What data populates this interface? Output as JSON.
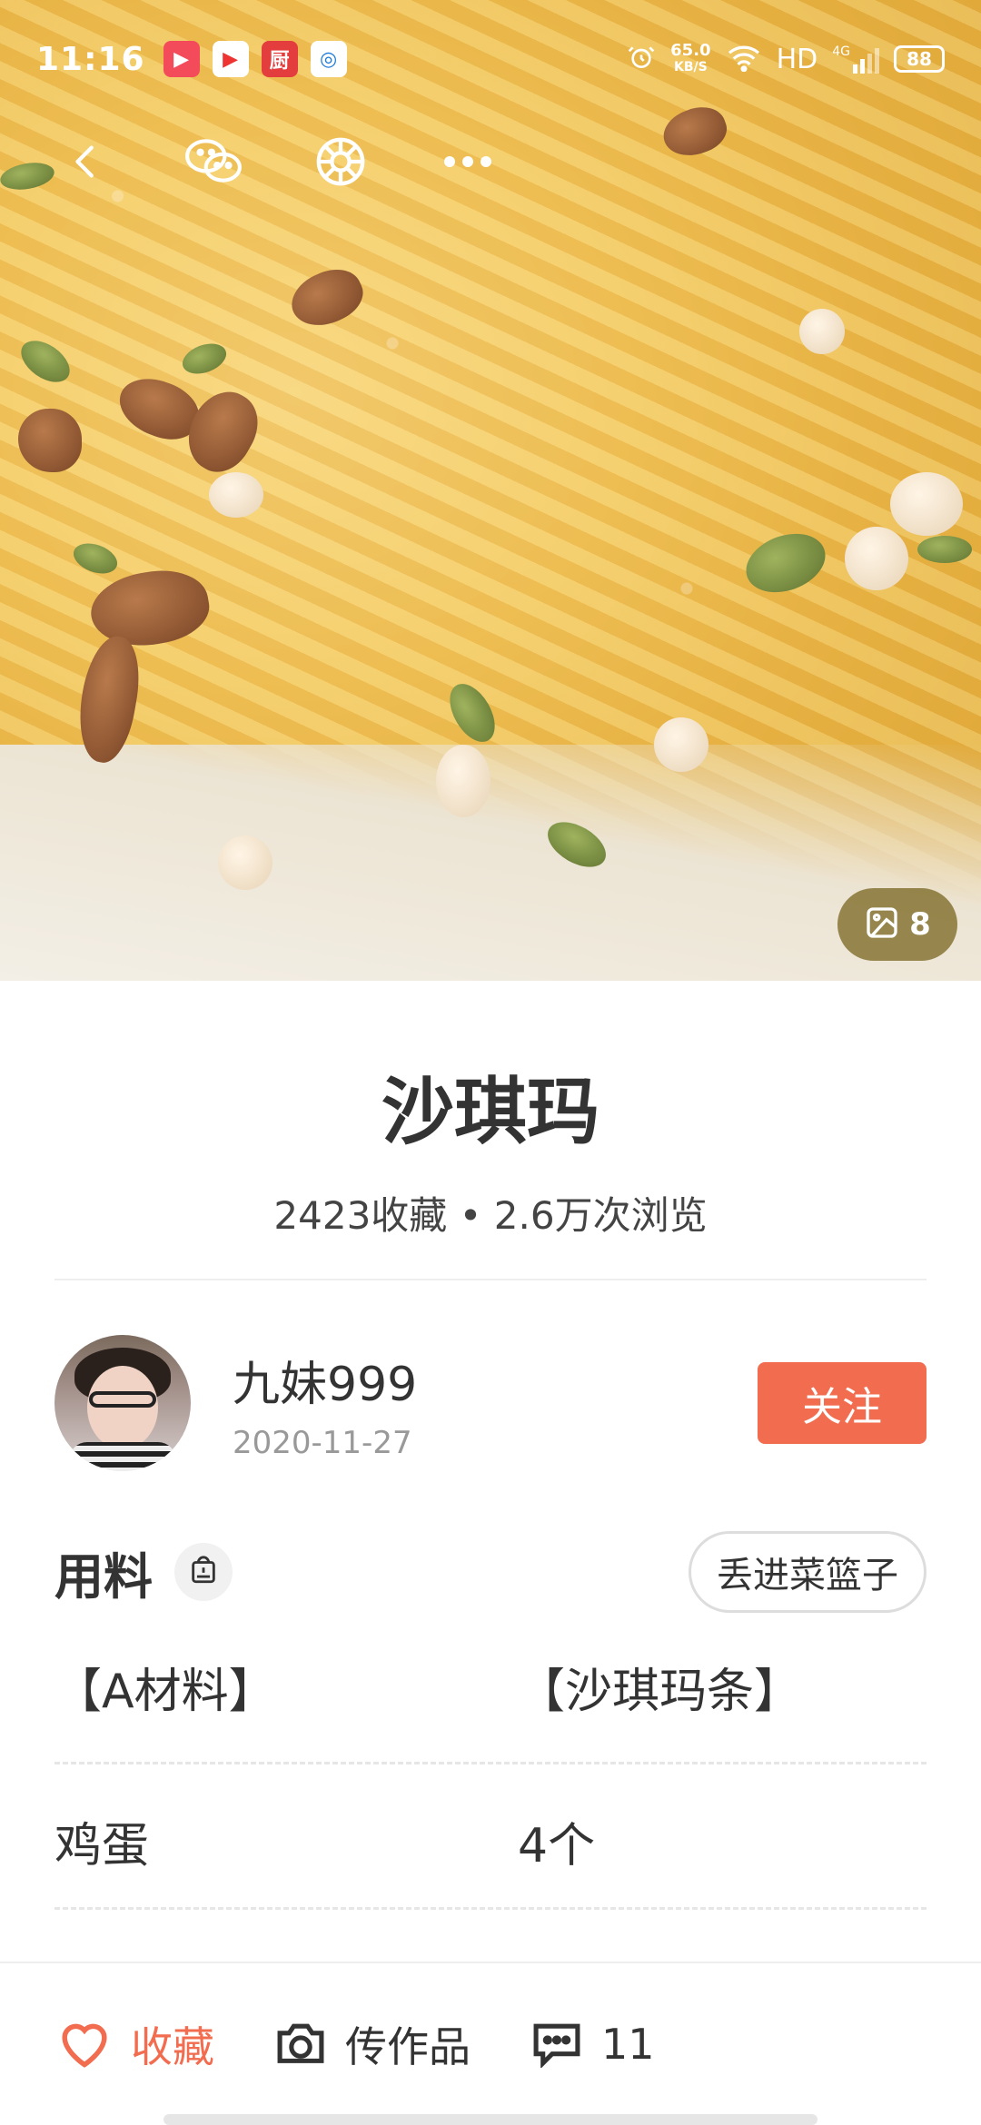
{
  "statusbar": {
    "time": "11:16",
    "net_speed_value": "65.0",
    "net_speed_unit": "KB/S",
    "hd": "HD",
    "net_type": "4G",
    "battery": "88"
  },
  "hero": {
    "photo_count": "8"
  },
  "recipe": {
    "title": "沙琪玛",
    "stats": "2423收藏 • 2.6万次浏览"
  },
  "author": {
    "name": "九妹999",
    "date": "2020-11-27",
    "follow_label": "关注"
  },
  "ingredients": {
    "title": "用料",
    "basket_label": "丢进菜篮子",
    "rows": [
      {
        "name": "【A材料】",
        "amount": "【沙琪玛条】"
      },
      {
        "name": "鸡蛋",
        "amount": "4个"
      }
    ]
  },
  "bottombar": {
    "favorite_label": "收藏",
    "upload_label": "传作品",
    "comments_count": "11"
  },
  "colors": {
    "accent": "#f26c4f",
    "text": "#333333",
    "muted": "#999999"
  },
  "icons": {
    "back": "back-icon",
    "wechat": "wechat-icon",
    "moments": "moments-icon",
    "more": "more-icon",
    "photo": "image-icon",
    "scale": "scale-icon",
    "heart": "heart-icon",
    "camera": "camera-icon",
    "comment": "comment-icon"
  }
}
